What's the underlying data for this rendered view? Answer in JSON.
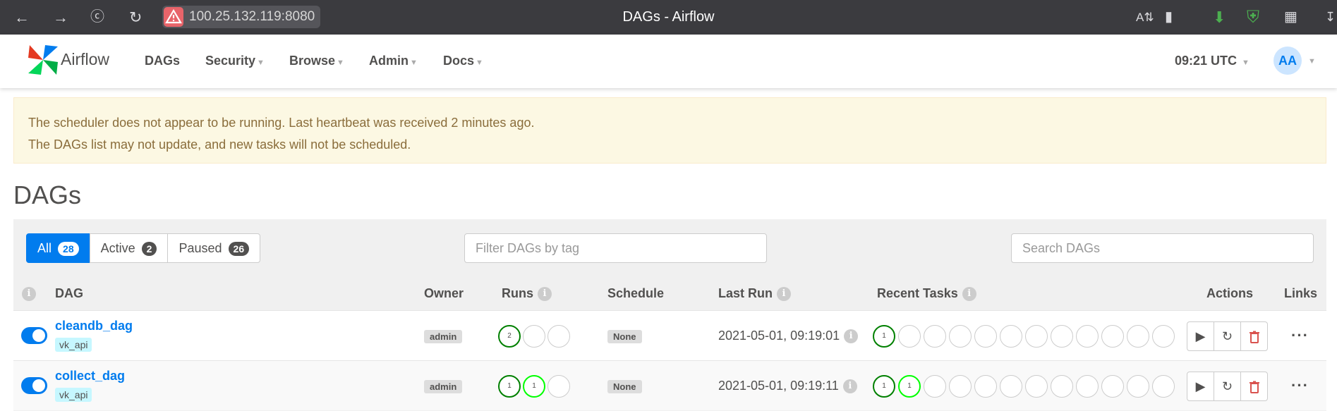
{
  "browser": {
    "url": "100.25.132.119:8080",
    "window_title": "DAGs - Airflow"
  },
  "navbar": {
    "brand": "Airflow",
    "items": [
      "DAGs",
      "Security",
      "Browse",
      "Admin",
      "Docs"
    ],
    "time": "09:21 UTC",
    "avatar": "AA"
  },
  "alert": {
    "line1": "The scheduler does not appear to be running. Last heartbeat was received 2 minutes ago.",
    "line2": "The DAGs list may not update, and new tasks will not be scheduled."
  },
  "page_title": "DAGs",
  "filters": {
    "all_label": "All",
    "all_count": "28",
    "active_label": "Active",
    "active_count": "2",
    "paused_label": "Paused",
    "paused_count": "26",
    "tag_placeholder": "Filter DAGs by tag",
    "search_placeholder": "Search DAGs"
  },
  "table": {
    "headers": {
      "info": "i",
      "dag": "DAG",
      "owner": "Owner",
      "runs": "Runs",
      "schedule": "Schedule",
      "last_run": "Last Run",
      "recent_tasks": "Recent Tasks",
      "actions": "Actions",
      "links": "Links"
    },
    "rows": [
      {
        "name": "cleandb_dag",
        "tag": "vk_api",
        "owner": "admin",
        "runs": [
          "2",
          "",
          ""
        ],
        "schedule": "None",
        "last_run": "2021-05-01, 09:19:01",
        "recent_tasks": [
          "1",
          "",
          "",
          "",
          "",
          "",
          "",
          "",
          "",
          "",
          "",
          ""
        ]
      },
      {
        "name": "collect_dag",
        "tag": "vk_api",
        "owner": "admin",
        "runs": [
          "1",
          "1",
          ""
        ],
        "schedule": "None",
        "last_run": "2021-05-01, 09:19:11",
        "recent_tasks": [
          "1",
          "1",
          "",
          "",
          "",
          "",
          "",
          "",
          "",
          "",
          "",
          ""
        ]
      }
    ]
  },
  "colors": {
    "accent": "#017cee",
    "success": "#008000",
    "running": "#00ff00",
    "alert_bg": "#fcf8e3",
    "alert_text": "#8a6d3b",
    "delete": "#d9534f"
  }
}
